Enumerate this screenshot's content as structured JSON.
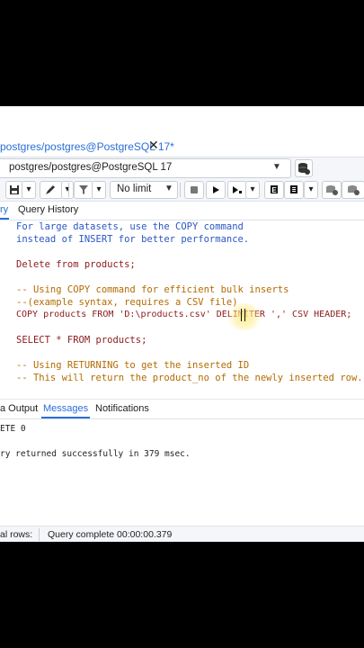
{
  "tab": {
    "title": "postgres/postgres@PostgreSQL 17*",
    "close": "✕"
  },
  "connection": {
    "value": "postgres/postgres@PostgreSQL 17",
    "caret": "⌄"
  },
  "toolbar": {
    "limit_label": "No limit",
    "limit_caret": "⌄"
  },
  "query_tabs": {
    "query": "ry",
    "history": "Query History"
  },
  "editor": {
    "lines": [
      "For large datasets, use the COPY command",
      "instead of INSERT for better performance.",
      "",
      "Delete from products;",
      "",
      "-- Using COPY command for efficient bulk inserts",
      "--(example syntax, requires a CSV file)",
      "COPY products FROM 'D:\\products.csv' DELIMITER ',' CSV HEADER;",
      "",
      "SELECT * FROM products;",
      "",
      "-- Using RETURNING to get the inserted ID",
      "-- This will return the product_no of the newly inserted row."
    ]
  },
  "result_tabs": {
    "data_output": "a Output",
    "messages": "Messages",
    "notifications": "Notifications"
  },
  "messages": {
    "line1": "ETE 0",
    "line2": "ry returned successfully in 379 msec."
  },
  "status": {
    "rows": "al rows:",
    "complete": "Query complete 00:00:00.379"
  },
  "colors": {
    "accent": "#2a6ed6",
    "keyword": "#8b1a1a",
    "comment": "#b36b00"
  }
}
